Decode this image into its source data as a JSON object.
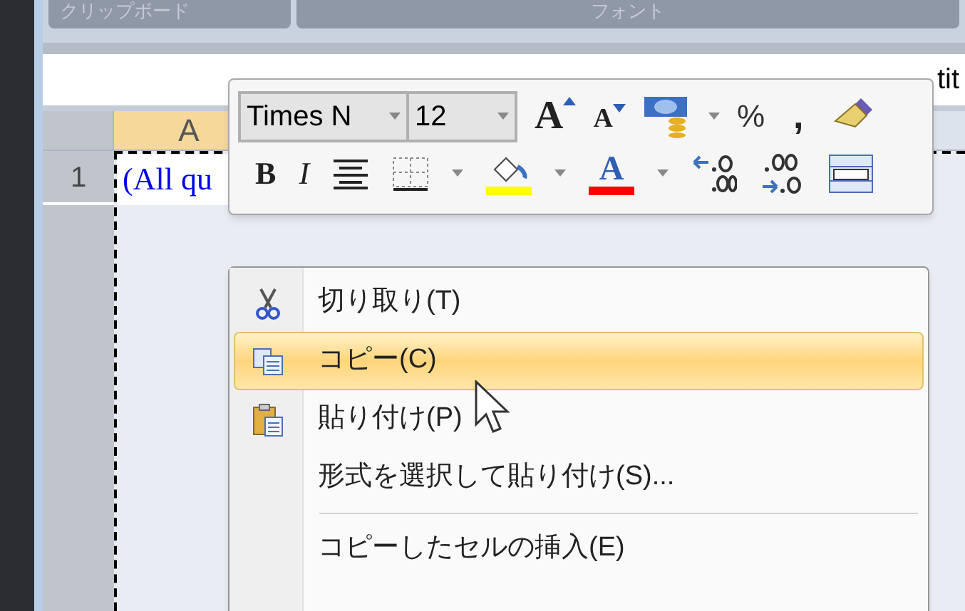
{
  "ribbon_groups": [
    {
      "label": "クリップボード"
    },
    {
      "label": "フォント"
    }
  ],
  "formula_bar": {
    "value": "tit"
  },
  "sheet": {
    "column_header": "A",
    "row_header": "1",
    "cell_text": "(All qu"
  },
  "mini_toolbar": {
    "font": "Times N",
    "size": "12",
    "grow_font": "A",
    "shrink_font": "A",
    "percent": "%",
    "comma": ",",
    "bold": "B",
    "italic": "I",
    "font_color": "A"
  },
  "context_menu": [
    {
      "label": "切り取り(T)",
      "kind": "cut",
      "selected": false
    },
    {
      "label": "コピー(C)",
      "kind": "copy",
      "selected": true
    },
    {
      "label": "貼り付け(P)",
      "kind": "paste",
      "selected": false
    },
    {
      "label": "形式を選択して貼り付け(S)...",
      "kind": "text",
      "selected": false
    },
    {
      "label": "コピーしたセルの挿入(E)",
      "kind": "text",
      "selected": false,
      "separator_before": true
    }
  ]
}
